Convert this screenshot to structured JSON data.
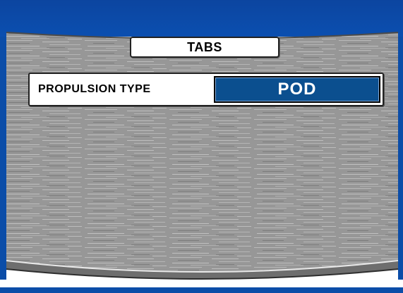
{
  "header": {
    "title": "TABS"
  },
  "setting": {
    "label": "PROPULSION TYPE",
    "value": "POD"
  },
  "colors": {
    "frame_blue": "#0b4da8",
    "value_blue": "#0b4f8f",
    "panel_gray": "#9a9a9a"
  }
}
